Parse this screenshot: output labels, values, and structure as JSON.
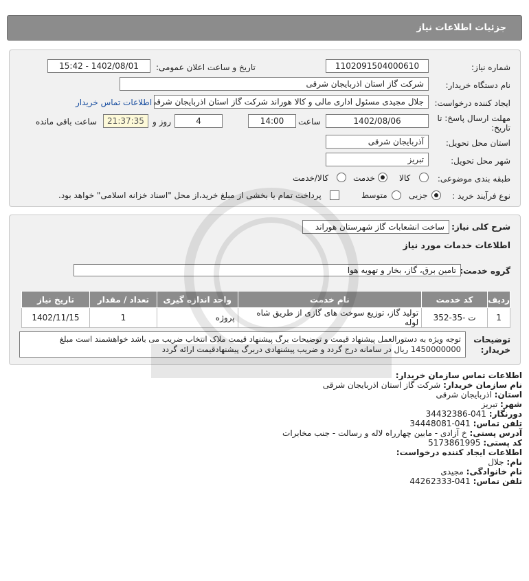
{
  "header": {
    "title": "جزئیات اطلاعات نیاز"
  },
  "form": {
    "need_number_label": "شماره نیاز:",
    "need_number": "1102091504000610",
    "announce_label": "تاریخ و ساعت اعلان عمومی:",
    "announce_value": "1402/08/01 - 15:42",
    "buyer_org_label": "نام دستگاه خریدار:",
    "buyer_org": "شرکت گاز استان اذربایجان شرقی",
    "creator_label": "ایجاد کننده درخواست:",
    "creator": "جلال مجیدی مسئول اداری مالی و کالا هوراند شرکت گاز استان اذربایجان شرقی",
    "buyer_contact_link": "اطلاعات تماس خریدار",
    "deadline_label_1": "مهلت ارسال پاسخ: تا",
    "deadline_label_2": "تاریخ:",
    "deadline_date": "1402/08/06",
    "time_label": "ساعت",
    "deadline_time": "14:00",
    "days_value": "4",
    "days_label": "روز و",
    "remaining_time": "21:37:35",
    "remaining_label": "ساعت باقی مانده",
    "province_label": "استان محل تحویل:",
    "province": "آذربایجان شرقی",
    "city_label": "شهر محل تحویل:",
    "city": "تبریز",
    "category_label": "طبقه بندی موضوعی:",
    "category_options": [
      "کالا",
      "خدمت",
      "کالا/خدمت"
    ],
    "category_selected": "خدمت",
    "process_label": "نوع فرآیند خرید :",
    "process_options": [
      "جزیی",
      "متوسط"
    ],
    "process_selected": "جزیی",
    "treasury_note": "پرداخت تمام یا بخشی از مبلغ خرید،از محل \"اسناد خزانه اسلامی\" خواهد بود."
  },
  "details": {
    "summary_label": "شرح کلی نیاز:",
    "summary": "ساخت انشعابات گاز شهرستان هوراند",
    "services_heading": "اطلاعات خدمات مورد نیاز",
    "service_group_label": "گروه خدمت:",
    "service_group": "تامین برق، گاز، بخار و تهویه هوا",
    "table": {
      "headers": [
        "ردیف",
        "کد خدمت",
        "نام خدمت",
        "واحد اندازه گیری",
        "تعداد / مقدار",
        "تاریخ نیاز"
      ],
      "rows": [
        [
          "1",
          "ت -35-352",
          "تولید گاز، توزیع سوخت های گازی از طریق شاه لوله",
          "پروژه",
          "1",
          "1402/11/15"
        ]
      ]
    },
    "notes_label": "توضیحات خریدار:",
    "notes": "توجه ویژه به دستورالعمل پیشنهاد قیمت و توضیحات برگ پیشنهاد قیمت ملاک انتخاب ضریب می باشد خواهشمند است مبلغ 1450000000 ریال در سامانه درج گردد و ضریب پیشنهادی دربرگ پیشنهادقیمت ارائه گردد"
  },
  "contact": {
    "heading": "اطلاعات تماس سازمان خریدار:",
    "org_label": "نام سازمان خریدار:",
    "org": "شرکت گاز استان اذربایجان شرقی",
    "province_label": "استان:",
    "province": "اذربایجان شرقی",
    "city_label": "شهر:",
    "city": "تبریز",
    "fax_label": "دورنگار:",
    "fax": "041-34432386",
    "phone_label": "تلفن تماس:",
    "phone": "041-34448081",
    "address_label": "آدرس پستی:",
    "address": "خ آزادی - مابین چهارراه لاله و رسالت - جنب مخابرات",
    "postal_label": "کد پستی:",
    "postal": "5173861995",
    "creator_heading": "اطلاعات ایجاد کننده درخواست:",
    "first_name_label": "نام:",
    "first_name": "جلال",
    "last_name_label": "نام خانوادگی:",
    "last_name": "مجیدی",
    "creator_phone_label": "تلفن تماس:",
    "creator_phone": "041-44262333"
  }
}
